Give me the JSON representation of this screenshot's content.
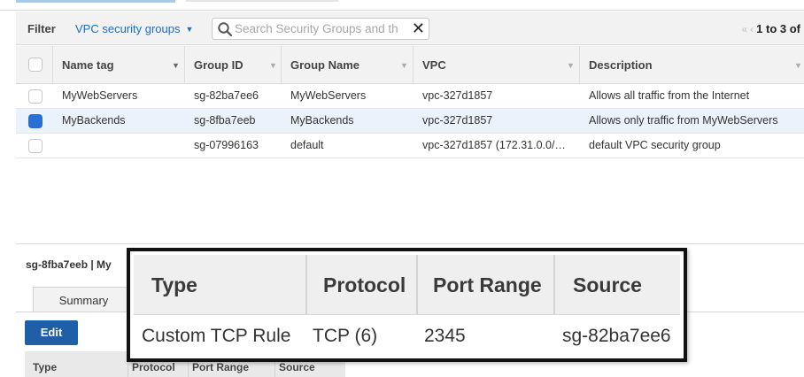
{
  "filter": {
    "label": "Filter",
    "dropdown_value": "VPC security groups",
    "search_placeholder": "Search Security Groups and th",
    "pager_text": "1 to 3 of"
  },
  "table": {
    "columns": [
      "Name tag",
      "Group ID",
      "Group Name",
      "VPC",
      "Description"
    ],
    "rows": [
      {
        "selected": false,
        "name_tag": "MyWebServers",
        "group_id": "sg-82ba7ee6",
        "group_name": "MyWebServers",
        "vpc": "vpc-327d1857",
        "description": "Allows all traffic from the Internet"
      },
      {
        "selected": true,
        "name_tag": "MyBackends",
        "group_id": "sg-8fba7eeb",
        "group_name": "MyBackends",
        "vpc": "vpc-327d1857",
        "description": "Allows only traffic from MyWebServers"
      },
      {
        "selected": false,
        "name_tag": "",
        "group_id": "sg-07996163",
        "group_name": "default",
        "vpc": "vpc-327d1857 (172.31.0.0/…",
        "description": "default VPC security group"
      }
    ]
  },
  "detail": {
    "title": "sg-8fba7eeb | My",
    "tab_summary": "Summary",
    "edit_label": "Edit",
    "rules_columns": [
      "Type",
      "Protocol",
      "Port Range",
      "Source"
    ]
  },
  "zoom": {
    "columns": [
      "Type",
      "Protocol",
      "Port Range",
      "Source"
    ],
    "row": {
      "type": "Custom TCP Rule",
      "protocol": "TCP (6)",
      "port_range": "2345",
      "source": "sg-82ba7ee6"
    }
  },
  "colors": {
    "accent_link": "#1a6fc4",
    "selected_checkbox": "#2a6fd6",
    "edit_button": "#1f5fa8",
    "selected_row_bg": "#eaf3fc"
  },
  "icons": [
    "search-icon",
    "clear-icon",
    "chevron-down-icon",
    "first-page-icon",
    "prev-page-icon",
    "sort-icon"
  ]
}
